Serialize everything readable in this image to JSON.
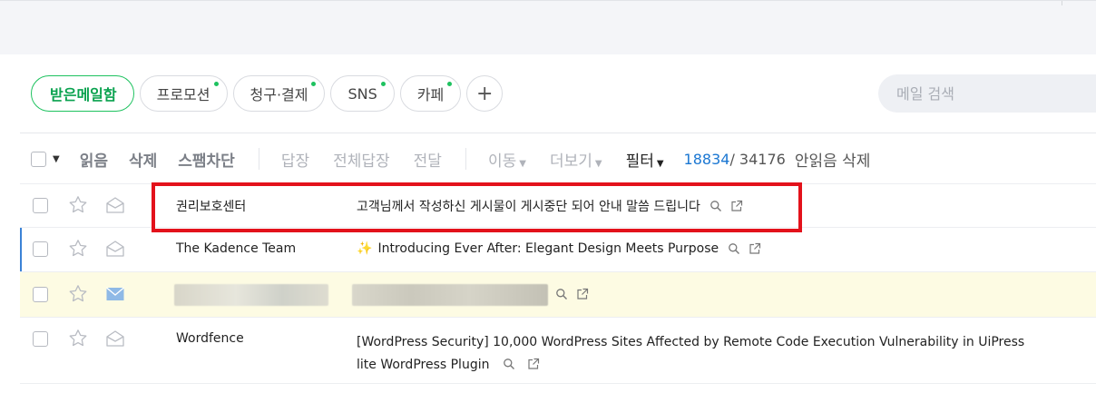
{
  "tabs": [
    {
      "label": "받은메일함",
      "active": true,
      "dot": false
    },
    {
      "label": "프로모션",
      "active": false,
      "dot": true
    },
    {
      "label": "청구·결제",
      "active": false,
      "dot": true
    },
    {
      "label": "SNS",
      "active": false,
      "dot": true
    },
    {
      "label": "카페",
      "active": false,
      "dot": true
    }
  ],
  "tab_add_label": "+",
  "search": {
    "placeholder": "메일 검색"
  },
  "toolbar": {
    "read": "읽음",
    "delete": "삭제",
    "spam": "스팸차단",
    "reply": "답장",
    "reply_all": "전체답장",
    "forward": "전달",
    "move": "이동",
    "more": "더보기",
    "filter": "필터",
    "unread_count": "18834",
    "total_count": "/ 34176",
    "delete_unread": "안읽음 삭제"
  },
  "mails": [
    {
      "sender": "권리보호센터",
      "subject": "고객님께서 작성하신 게시물이 게시중단 되어 안내 말씀 드립니다",
      "read": true,
      "highlighted": true
    },
    {
      "sender": "The Kadence Team",
      "subject_emoji": "✨",
      "subject": "Introducing Ever After: Elegant Design Meets Purpose",
      "read": true
    },
    {
      "sender": "",
      "subject": "",
      "read": false,
      "redacted": true
    },
    {
      "sender": "Wordfence",
      "subject": "[WordPress Security] 10,000 WordPress Sites Affected by Remote Code Execution Vulnerability in UiPress lite WordPress Plugin",
      "read": true
    }
  ],
  "colors": {
    "accent_green": "#1ec25f",
    "link_blue": "#1b77d2",
    "highlight_red": "#e3121b",
    "unread_row_bg": "#fdfbe3"
  }
}
